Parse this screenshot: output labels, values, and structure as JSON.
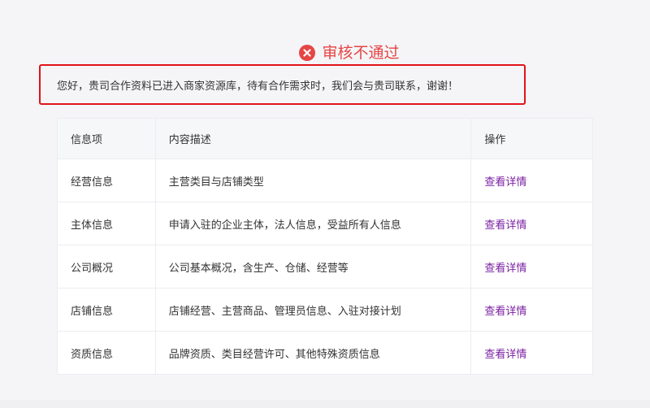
{
  "status": {
    "title": "审核不通过",
    "icon": "close-circle-icon",
    "color": "#e64545"
  },
  "message": {
    "text": "您好，贵司合作资料已进入商家资源库，待有合作需求时，我们会与贵司联系，谢谢！",
    "highlight_color": "#e0131a"
  },
  "table": {
    "headers": [
      "信息项",
      "内容描述",
      "操作"
    ],
    "rows": [
      {
        "item": "经营信息",
        "desc": "主营类目与店铺类型",
        "action": "查看详情"
      },
      {
        "item": "主体信息",
        "desc": "申请入驻的企业主体，法人信息，受益所有人信息",
        "action": "查看详情"
      },
      {
        "item": "公司概况",
        "desc": "公司基本概况，含生产、仓储、经营等",
        "action": "查看详情"
      },
      {
        "item": "店铺信息",
        "desc": "店铺经营、主营商品、管理员信息、入驻对接计划",
        "action": "查看详情"
      },
      {
        "item": "资质信息",
        "desc": "品牌资质、类目经营许可、其他特殊资质信息",
        "action": "查看详情"
      }
    ]
  },
  "colors": {
    "link": "#7a1fa2",
    "background": "#f5f5f7",
    "table_header_bg": "#f6f7f9",
    "border": "#ebedf0"
  }
}
